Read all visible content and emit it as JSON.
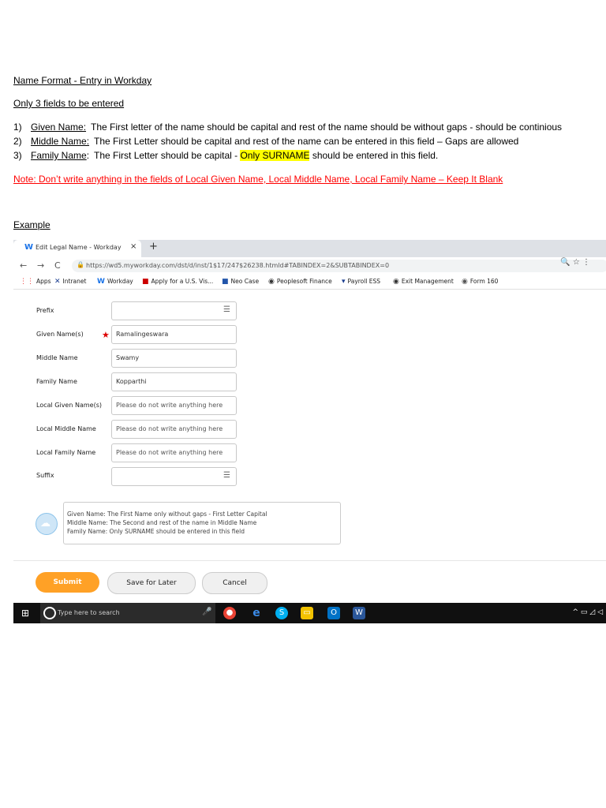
{
  "doc": {
    "title": "Name Format - Entry in Workday",
    "subtitle": "Only 3 fields to be entered",
    "rules": [
      {
        "num": "1)",
        "label": "Given Name:",
        "text": "The First letter of the name should be capital and rest of the name should be without gaps - should be continious"
      },
      {
        "num": "2)",
        "label": "Middle Name:",
        "text": "The First Letter should be capital and rest of the name can be entered in this field – Gaps are allowed"
      },
      {
        "num": "3)",
        "label": "Family Name",
        "colon": ":",
        "text_before": "The First Letter should be capital -",
        "highlight": "Only SURNAME",
        "text_after": "should be entered in this field."
      }
    ],
    "note": "Note: Don’t write anything in the fields of Local Given Name, Local Middle Name, Local Family Name – Keep It Blank",
    "example_label": "Example"
  },
  "browser": {
    "tab_title": "Edit Legal Name - Workday",
    "tab_icon": "W",
    "tab_close": "×",
    "new_tab": "+",
    "nav": {
      "back": "←",
      "forward": "→",
      "reload": "C"
    },
    "url": "https://wd5.myworkday.com/dst/d/inst/1$17/247$26238.htmld#TABINDEX=2&SUBTABINDEX=0",
    "url_tools": "🔍  ☆  ⋮",
    "bookmarks": [
      "Apps",
      "Intranet",
      "Workday",
      "Apply for a U.S. Vis...",
      "Neo Case",
      "Peoplesoft Finance",
      "Payroll ESS",
      "Exit Management",
      "Form 160"
    ]
  },
  "form": {
    "fields": [
      {
        "label": "Prefix",
        "value": "",
        "type": "list"
      },
      {
        "label": "Given Name(s)",
        "value": "Ramalingeswara",
        "required": true
      },
      {
        "label": "Middle Name",
        "value": "Swamy"
      },
      {
        "label": "Family Name",
        "value": "Kopparthi"
      },
      {
        "label": "Local Given Name(s)",
        "placeholder": "Please do not write anything here"
      },
      {
        "label": "Local Middle Name",
        "placeholder": "Please do not write anything here"
      },
      {
        "label": "Local Family Name",
        "placeholder": "Please do not write anything here"
      },
      {
        "label": "Suffix",
        "value": "",
        "type": "list"
      }
    ],
    "required_mark": "★",
    "list_icon": "☰",
    "help_lines": [
      "Given Name:   The First Name only without gaps - First Letter Capital",
      "Middle Name:  The Second and rest of the name in Middle Name",
      "Family Name:  Only SURNAME should be entered in this field"
    ],
    "buttons": {
      "submit": "Submit",
      "save_later": "Save for Later",
      "cancel": "Cancel"
    }
  },
  "taskbar": {
    "search_placeholder": "Type here to search",
    "tray": "^ ▭ ◿ ◁"
  },
  "colors": {
    "note_red": "#ff0000",
    "highlight": "#ffff00",
    "submit_orange": "#ffa126"
  }
}
